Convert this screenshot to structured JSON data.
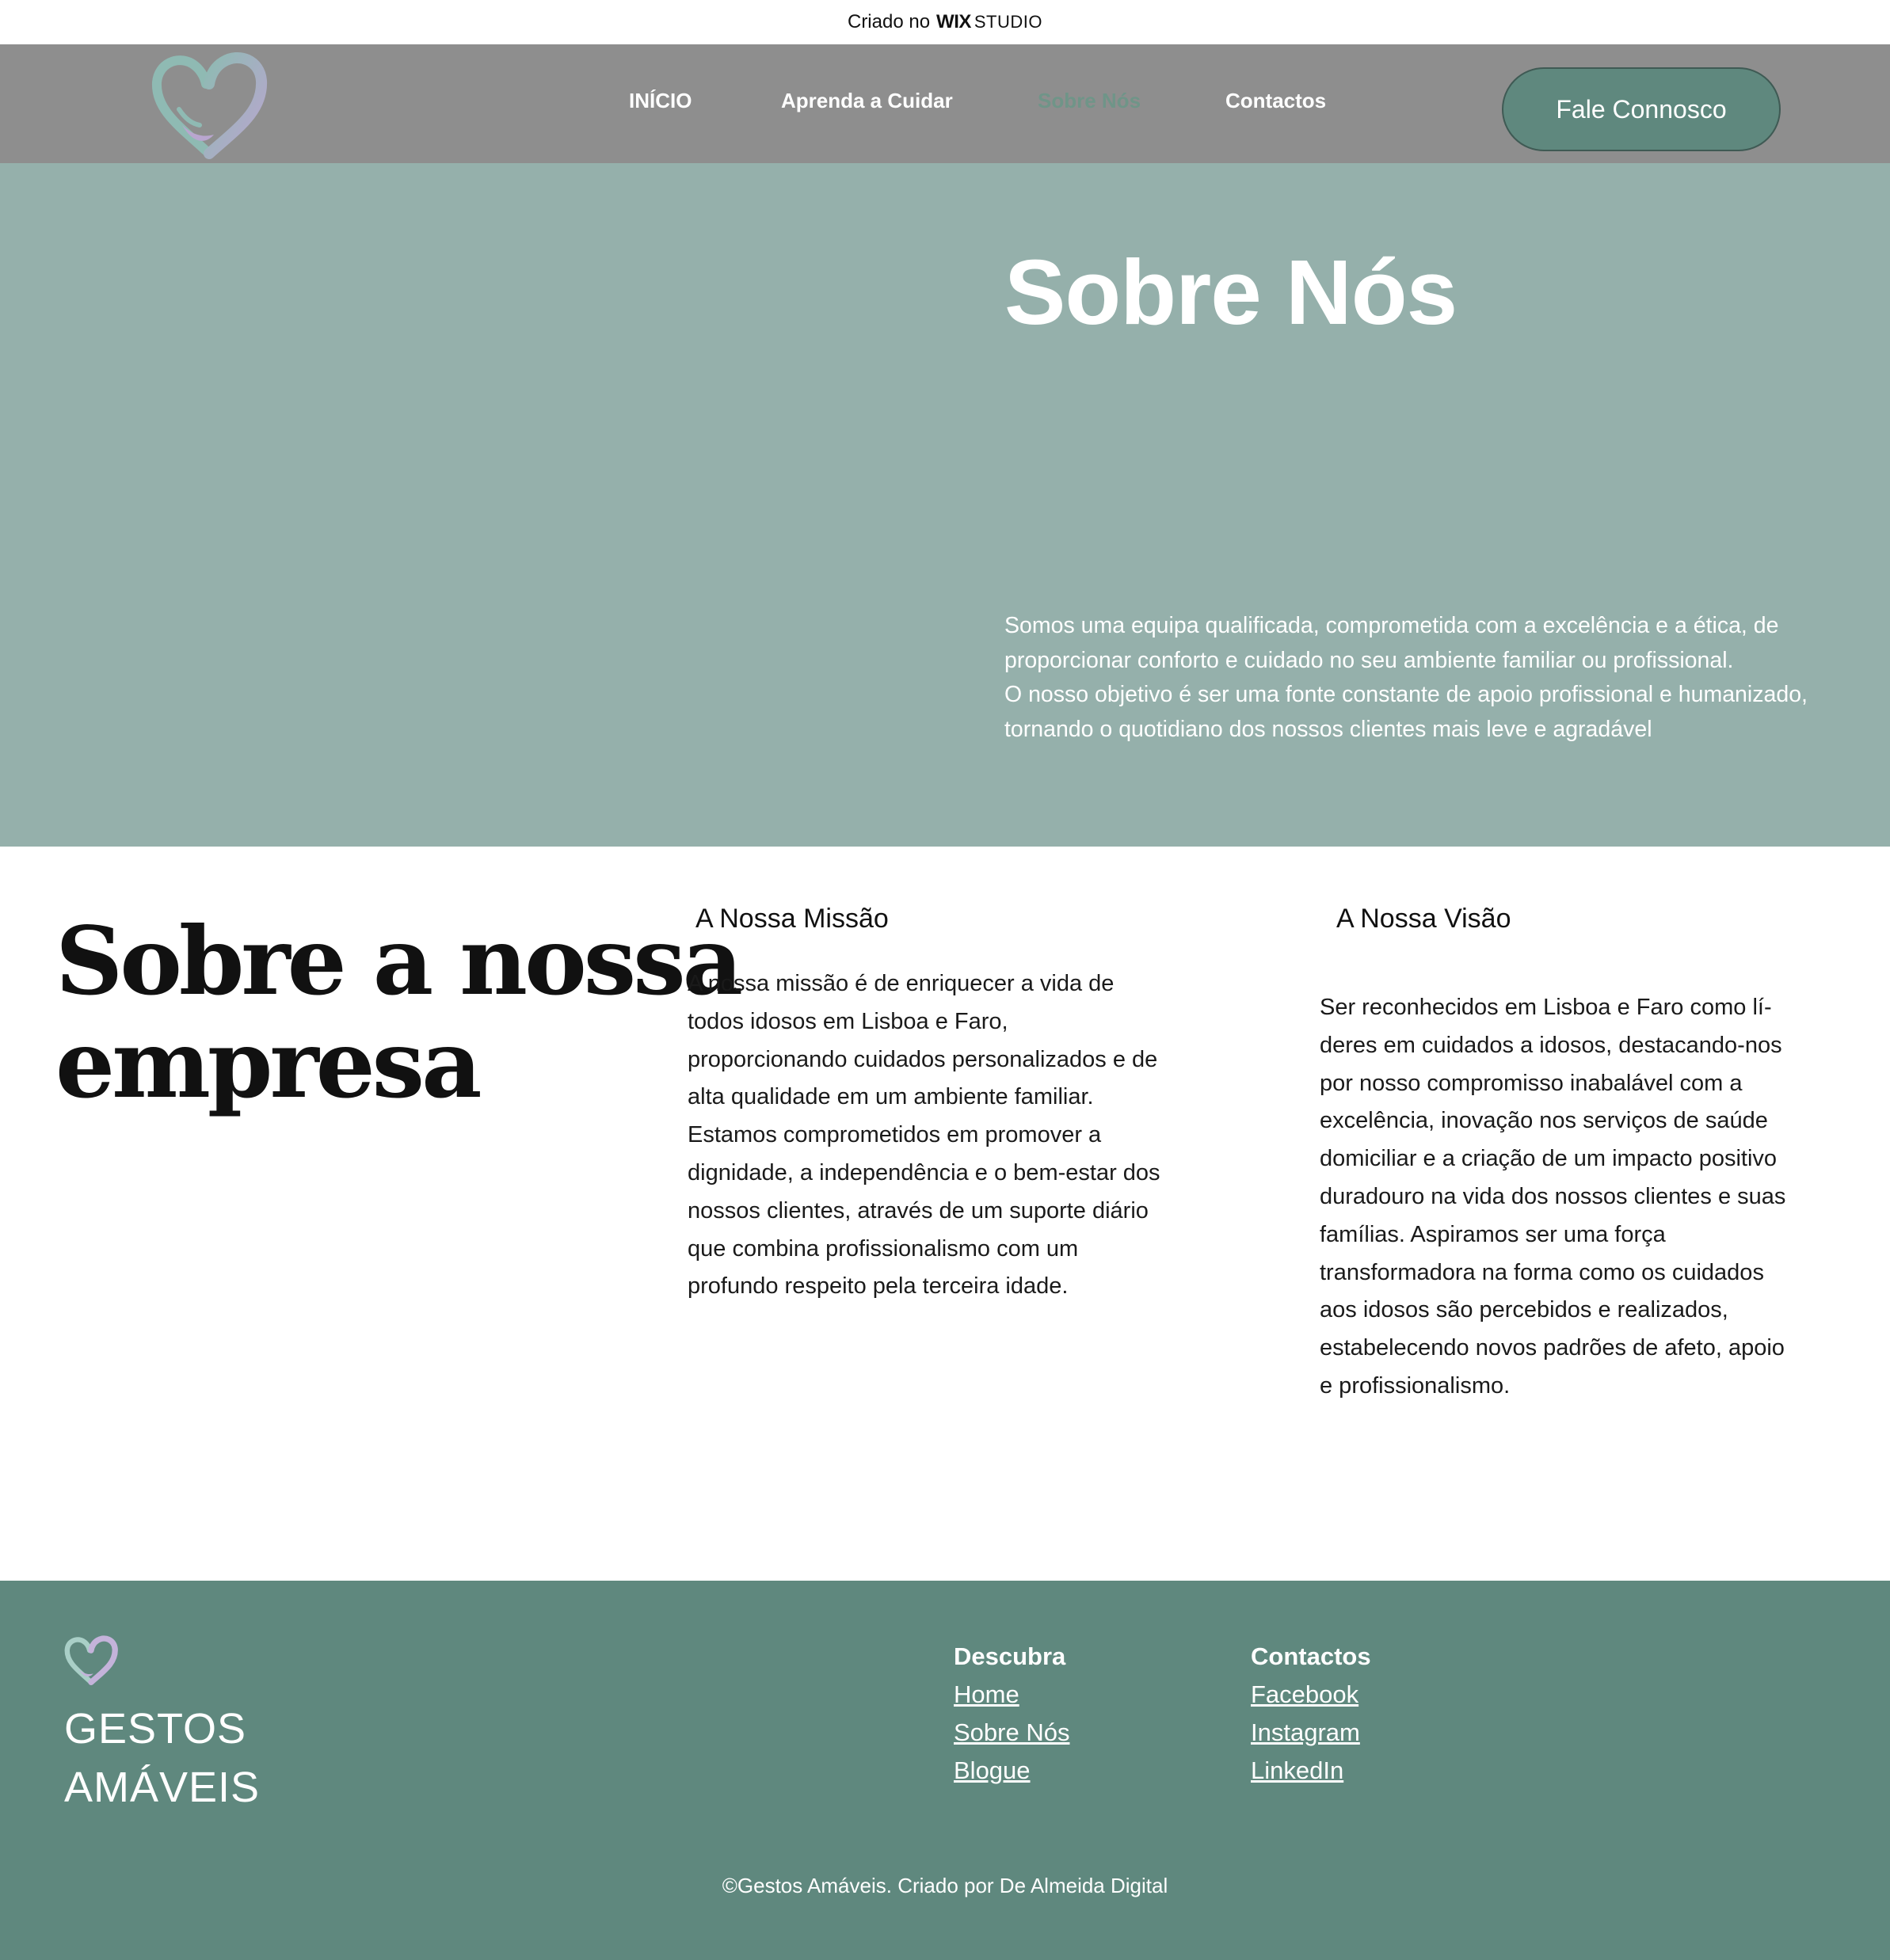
{
  "banner": {
    "prefix": "Criado no",
    "brand": "WIX",
    "product": "STUDIO"
  },
  "header": {
    "logo_icon": "heart-hands-icon",
    "nav": [
      {
        "label": "INÍCIO",
        "active": false
      },
      {
        "label": "Aprenda a Cuidar",
        "active": false
      },
      {
        "label": "Sobre Nós",
        "active": true
      },
      {
        "label": "Contactos",
        "active": false
      }
    ],
    "cta_label": "Fale Connosco"
  },
  "hero": {
    "title": "Sobre Nós",
    "lines": [
      "Somos uma equipa qualificada, comprometida com a excelência e a ética, de",
      "proporcionar conforto e cuidado no seu ambiente familiar ou profissional.",
      "O nosso objetivo é ser uma fonte constante de apoio profissional e humanizado,",
      "tornando o quotidiano dos nossos clientes mais leve e agradável"
    ]
  },
  "about": {
    "title_line1": "Sobre a nossa",
    "title_line2": "empresa",
    "mission": {
      "title": "A Nossa Missão",
      "lines": [
        "A nossa missão é de enriquecer a vida de",
        "todos idosos em Lisboa e Faro,",
        "proporcionando cuidados personalizados e de",
        "alta qualidade em um ambiente familiar.",
        "Estamos comprometidos em promover a",
        "dignidade, a independência e o bem-estar dos",
        "nossos clientes, através de um suporte diário",
        "que combina profissionalismo com um",
        "profundo respeito pela terceira idade."
      ]
    },
    "vision": {
      "title": "A Nossa Visão",
      "lines": [
        "Ser reconhecidos em Lisboa e Faro como lí-",
        "deres em cuidados a idosos, destacando-nos",
        "por nosso compromisso inabalável com a",
        "excelência, inovação nos serviços de saúde",
        "domiciliar e a criação de um impacto positivo",
        "duradouro na vida dos nossos clientes e suas",
        "famílias. Aspiramos ser uma força",
        "transformadora na forma como os cuidados",
        "aos idosos são percebidos e realizados,",
        "estabelecendo novos padrões de afeto, apoio",
        "e profissionalismo."
      ]
    }
  },
  "footer": {
    "brand_line1": "GESTOS",
    "brand_line2": "AMÁVEIS",
    "discover": {
      "title": "Descubra",
      "links": [
        "Home",
        "Sobre Nós",
        "Blogue"
      ]
    },
    "contacts": {
      "title": "Contactos",
      "links": [
        "Facebook",
        "Instagram",
        "LinkedIn"
      ]
    },
    "copyright": "©Gestos Amáveis. Criado por De Almeida Digital"
  },
  "colors": {
    "header_bg": "#8e8e8e",
    "hero_bg": "#95b0ab",
    "accent": "#5f887e",
    "active_nav": "#6f9588",
    "logo_lilac": "#b9a6cf",
    "logo_teal": "#8fbab3"
  }
}
